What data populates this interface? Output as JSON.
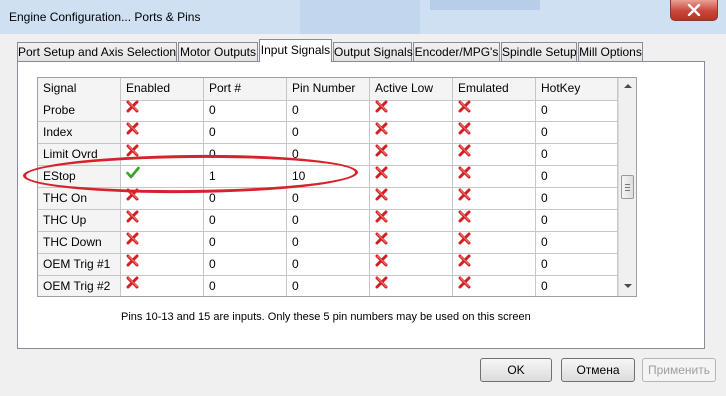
{
  "window": {
    "title": "Engine Configuration... Ports & Pins"
  },
  "tabs": [
    {
      "label": "Port Setup and Axis Selection",
      "active": false
    },
    {
      "label": "Motor Outputs",
      "active": false
    },
    {
      "label": "Input Signals",
      "active": true
    },
    {
      "label": "Output Signals",
      "active": false
    },
    {
      "label": "Encoder/MPG's",
      "active": false
    },
    {
      "label": "Spindle Setup",
      "active": false
    },
    {
      "label": "Mill Options",
      "active": false
    }
  ],
  "grid": {
    "columns": [
      "Signal",
      "Enabled",
      "Port #",
      "Pin Number",
      "Active Low",
      "Emulated",
      "HotKey"
    ],
    "rows": [
      {
        "signal": "Probe",
        "enabled": false,
        "port": "0",
        "pin": "0",
        "active_low": false,
        "emulated": false,
        "hotkey": "0"
      },
      {
        "signal": "Index",
        "enabled": false,
        "port": "0",
        "pin": "0",
        "active_low": false,
        "emulated": false,
        "hotkey": "0"
      },
      {
        "signal": "Limit Ovrd",
        "enabled": false,
        "port": "0",
        "pin": "0",
        "active_low": false,
        "emulated": false,
        "hotkey": "0"
      },
      {
        "signal": "EStop",
        "enabled": true,
        "port": "1",
        "pin": "10",
        "active_low": false,
        "emulated": false,
        "hotkey": "0"
      },
      {
        "signal": "THC On",
        "enabled": false,
        "port": "0",
        "pin": "0",
        "active_low": false,
        "emulated": false,
        "hotkey": "0"
      },
      {
        "signal": "THC Up",
        "enabled": false,
        "port": "0",
        "pin": "0",
        "active_low": false,
        "emulated": false,
        "hotkey": "0"
      },
      {
        "signal": "THC Down",
        "enabled": false,
        "port": "0",
        "pin": "0",
        "active_low": false,
        "emulated": false,
        "hotkey": "0"
      },
      {
        "signal": "OEM Trig #1",
        "enabled": false,
        "port": "0",
        "pin": "0",
        "active_low": false,
        "emulated": false,
        "hotkey": "0"
      },
      {
        "signal": "OEM Trig #2",
        "enabled": false,
        "port": "0",
        "pin": "0",
        "active_low": false,
        "emulated": false,
        "hotkey": "0"
      }
    ]
  },
  "note": "Pins 10-13 and 15 are inputs. Only these 5 pin numbers may be used on this screen",
  "buttons": {
    "ok": "OK",
    "cancel": "Отмена",
    "apply": "Применить"
  },
  "icons": {
    "enabled_on": "green-check-icon",
    "enabled_off": "red-x-icon",
    "close": "close-icon"
  },
  "colors": {
    "annotation": "#d8222a",
    "check": "#3aa12a",
    "cross": "#d21f1f",
    "close_button": "#c9473a"
  }
}
